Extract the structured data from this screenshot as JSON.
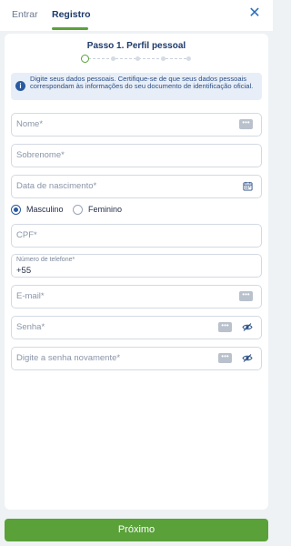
{
  "tabs": [
    {
      "label": "Entrar",
      "active": false
    },
    {
      "label": "Registro",
      "active": true
    }
  ],
  "header": {
    "close_icon": "close-icon"
  },
  "step": {
    "title": "Passo 1. Perfil pessoal",
    "current": 1,
    "total": 5
  },
  "info": {
    "text": "Digite seus dados pessoais. Certifique-se de que seus dados pessoais correspondam às informações do seu documento de identificação oficial."
  },
  "fields": {
    "nome": {
      "placeholder": "Nome*"
    },
    "sobrenome": {
      "placeholder": "Sobrenome*"
    },
    "nascimento": {
      "placeholder": "Data de nascimento*"
    },
    "cpf": {
      "placeholder": "CPF*"
    },
    "telefone": {
      "label": "Número de telefone*",
      "value": "+55"
    },
    "email": {
      "placeholder": "E-mail*"
    },
    "senha": {
      "placeholder": "Senha*"
    },
    "senha_confirm": {
      "placeholder": "Digite a senha novamente*"
    }
  },
  "gender": {
    "options": [
      "Masculino",
      "Feminino"
    ],
    "selected": "Masculino"
  },
  "actions": {
    "next_label": "Próximo"
  },
  "colors": {
    "accent": "#5aa13a",
    "brand": "#1d3a6b",
    "link": "#2d6fb8"
  }
}
